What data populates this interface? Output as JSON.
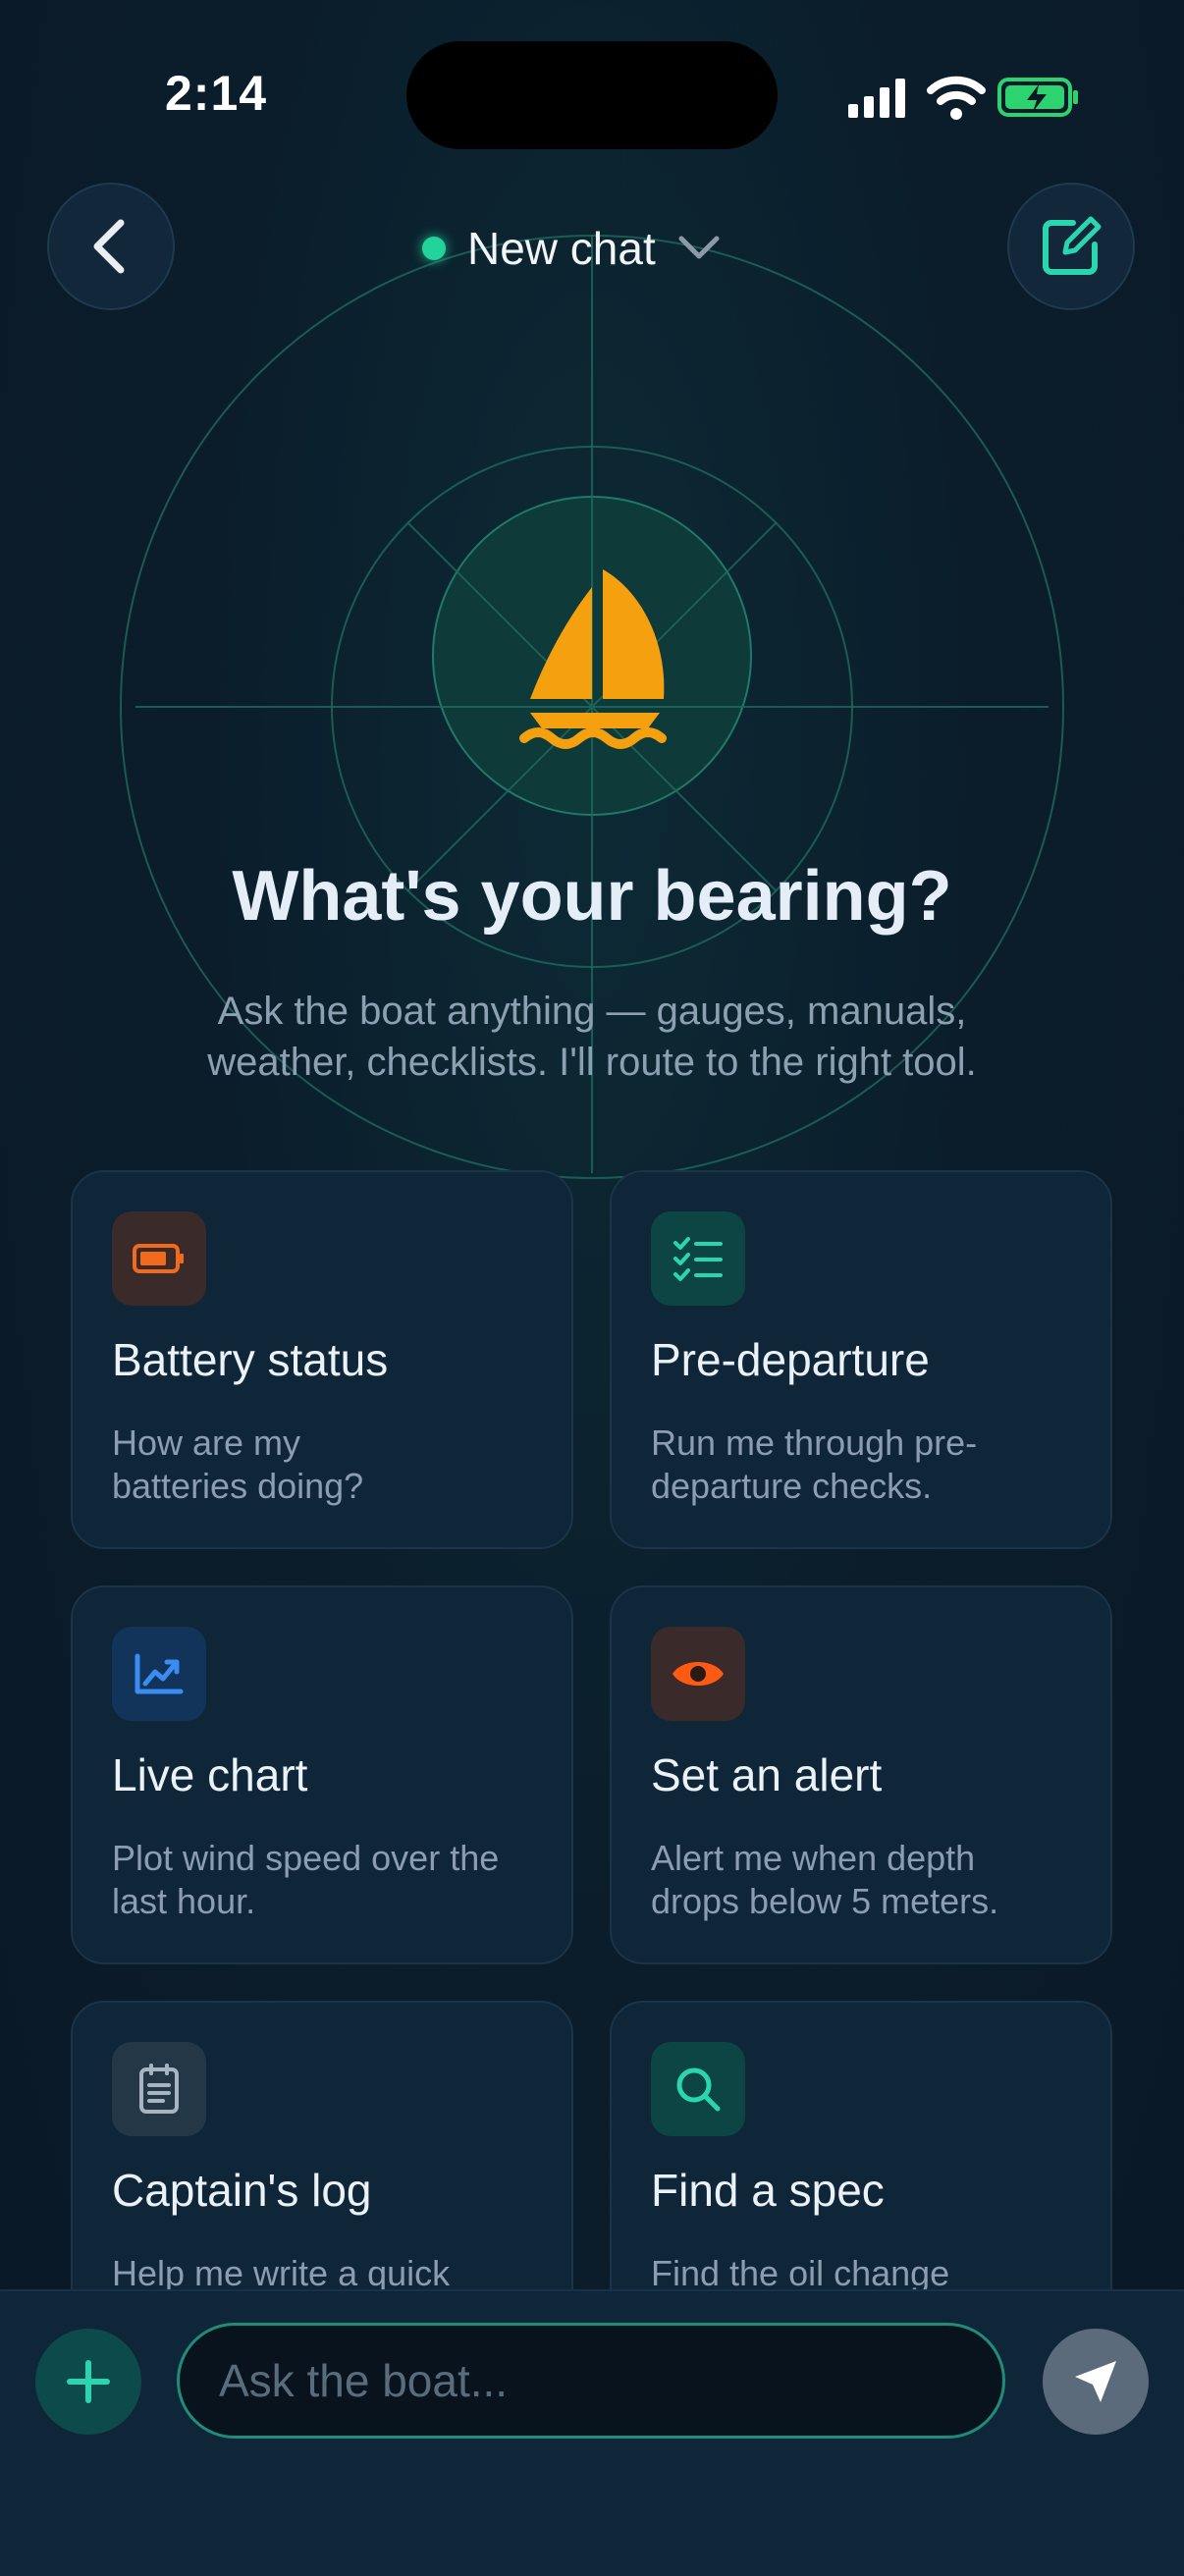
{
  "status_bar": {
    "time": "2:14"
  },
  "header": {
    "title": "New chat"
  },
  "hero": {
    "title": "What's your bearing?",
    "subtitle_line1": "Ask the boat anything — gauges, manuals,",
    "subtitle_line2": "weather, checklists. I'll route to the right tool."
  },
  "cards": [
    {
      "title": "Battery status",
      "desc": "How are my batteries doing?",
      "icon": "battery-icon",
      "color": "#f26b1d"
    },
    {
      "title": "Pre-departure",
      "desc": "Run me through pre-departure checks.",
      "icon": "checklist-icon",
      "color": "#2ad6b0"
    },
    {
      "title": "Live chart",
      "desc": "Plot wind speed over the last hour.",
      "icon": "trend-chart-icon",
      "color": "#3a8cf0"
    },
    {
      "title": "Set an alert",
      "desc": "Alert me when depth drops below 5 meters.",
      "icon": "eye-icon",
      "color": "#ff5a14"
    },
    {
      "title": "Captain's log",
      "desc": "Help me write a quick",
      "icon": "notepad-icon",
      "color": "#a7b4c2"
    },
    {
      "title": "Find a spec",
      "desc": "Find the oil change",
      "icon": "search-icon",
      "color": "#2ad6b0"
    }
  ],
  "composer": {
    "placeholder": "Ask the boat..."
  },
  "colors": {
    "accent": "#2ad6b0",
    "sail": "#f5a00f",
    "background": "#0b1d2b"
  }
}
